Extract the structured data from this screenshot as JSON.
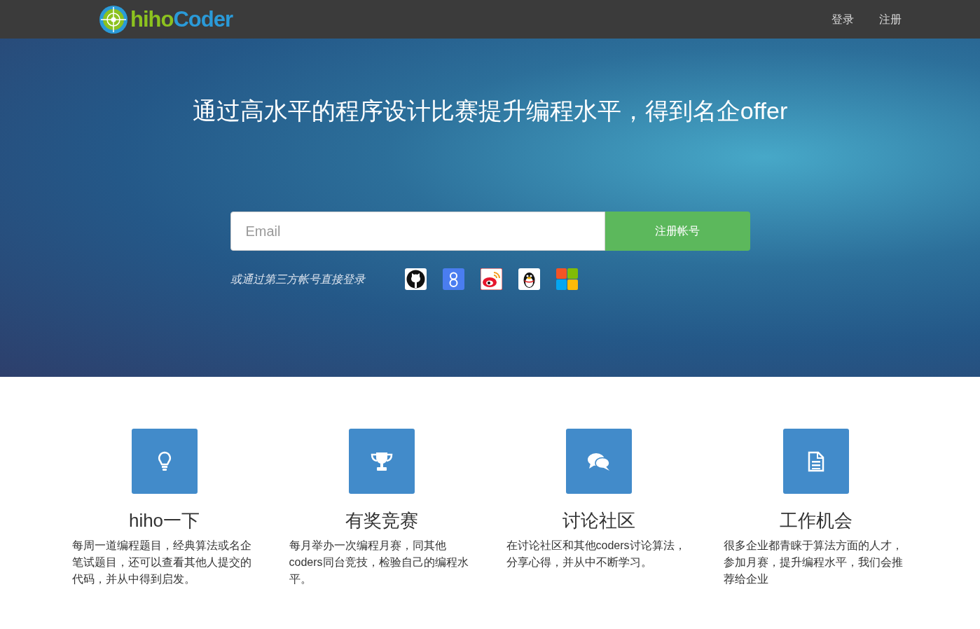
{
  "navbar": {
    "logo": {
      "green_part": "hiho",
      "blue_part": "Coder"
    },
    "links": [
      "登录",
      "注册"
    ]
  },
  "hero": {
    "headline": "通过高水平的程序设计比赛提升编程水平，得到名企offer",
    "email": {
      "placeholder": "Email"
    },
    "signup_button": "注册帐号",
    "third_party_label": "或通过第三方帐号直接登录",
    "providers": [
      {
        "kind": "github"
      },
      {
        "kind": "google"
      },
      {
        "kind": "weibo"
      },
      {
        "kind": "qq"
      },
      {
        "kind": "microsoft"
      }
    ]
  },
  "features": [
    {
      "kind": "bulb",
      "title": "hiho一下",
      "text": "每周一道编程题目，经典算法或名企笔试题目，还可以查看其他人提交的代码，并从中得到启发。"
    },
    {
      "kind": "trophy",
      "title": "有奖竞赛",
      "text": "每月举办一次编程月赛，同其他coders同台竞技，检验自己的编程水平。"
    },
    {
      "kind": "comments",
      "title": "讨论社区",
      "text": "在讨论社区和其他coders讨论算法，分享心得，并从中不断学习。"
    },
    {
      "kind": "file",
      "title": "工作机会",
      "text": "很多企业都青睐于算法方面的人才，参加月赛，提升编程水平，我们会推荐给企业"
    }
  ]
}
